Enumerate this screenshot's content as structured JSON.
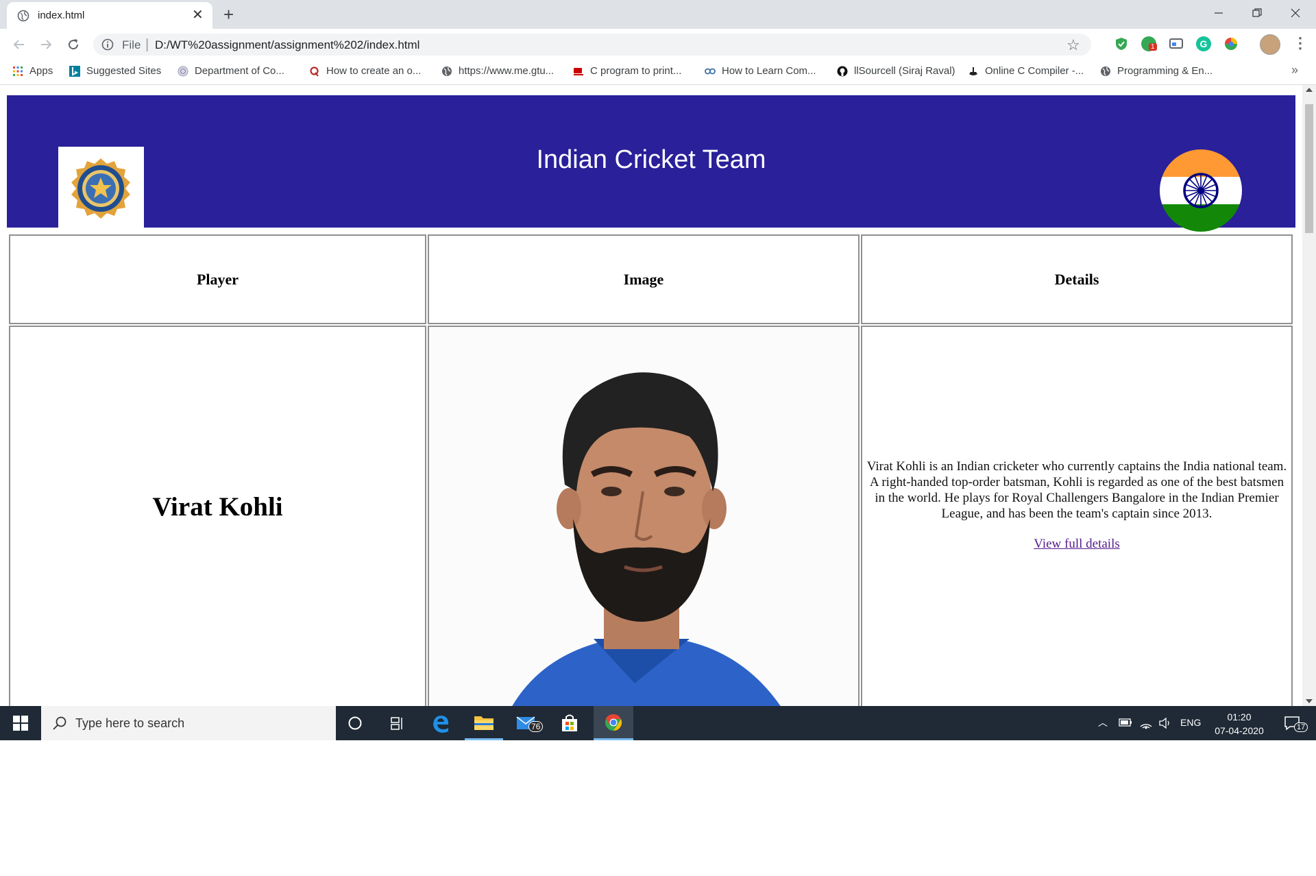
{
  "browser": {
    "tab_title": "index.html",
    "url_scheme_label": "File",
    "url": "D:/WT%20assignment/assignment%202/index.html",
    "extension_badge": "1"
  },
  "bookmarks": [
    {
      "label": "Apps",
      "icon": "apps-grid-icon"
    },
    {
      "label": "Suggested Sites",
      "icon": "bing-icon"
    },
    {
      "label": "Department of Co...",
      "icon": "globe-seal-icon"
    },
    {
      "label": "How to create an o...",
      "icon": "quora-icon"
    },
    {
      "label": "https://www.me.gtu...",
      "icon": "globe-icon"
    },
    {
      "label": "C program to print...",
      "icon": "cup-icon"
    },
    {
      "label": "How to Learn Com...",
      "icon": "goggles-icon"
    },
    {
      "label": "llSourcell (Siraj Raval)",
      "icon": "github-icon"
    },
    {
      "label": "Online C Compiler -...",
      "icon": "compiler-icon"
    },
    {
      "label": "Programming & En...",
      "icon": "globe-icon"
    }
  ],
  "page": {
    "header_title": "Indian Cricket Team",
    "table": {
      "headers": [
        "Player",
        "Image",
        "Details"
      ],
      "rows": [
        {
          "player": "Virat Kohli",
          "details": "Virat Kohli is an Indian cricketer who currently captains the India national team. A right-handed top-order batsman, Kohli is regarded as one of the best batsmen in the world. He plays for Royal Challengers Bangalore in the Indian Premier League, and has been the team's captain since 2013.",
          "link_text": "View full details"
        }
      ]
    }
  },
  "taskbar": {
    "search_placeholder": "Type here to search",
    "mail_badge": "76",
    "language": "ENG",
    "time": "01:20",
    "date": "07-04-2020",
    "notification_count": "17"
  },
  "colors": {
    "header_bg": "#29209a",
    "saffron": "#ff9933",
    "green": "#138808",
    "link": "#551a8b"
  }
}
